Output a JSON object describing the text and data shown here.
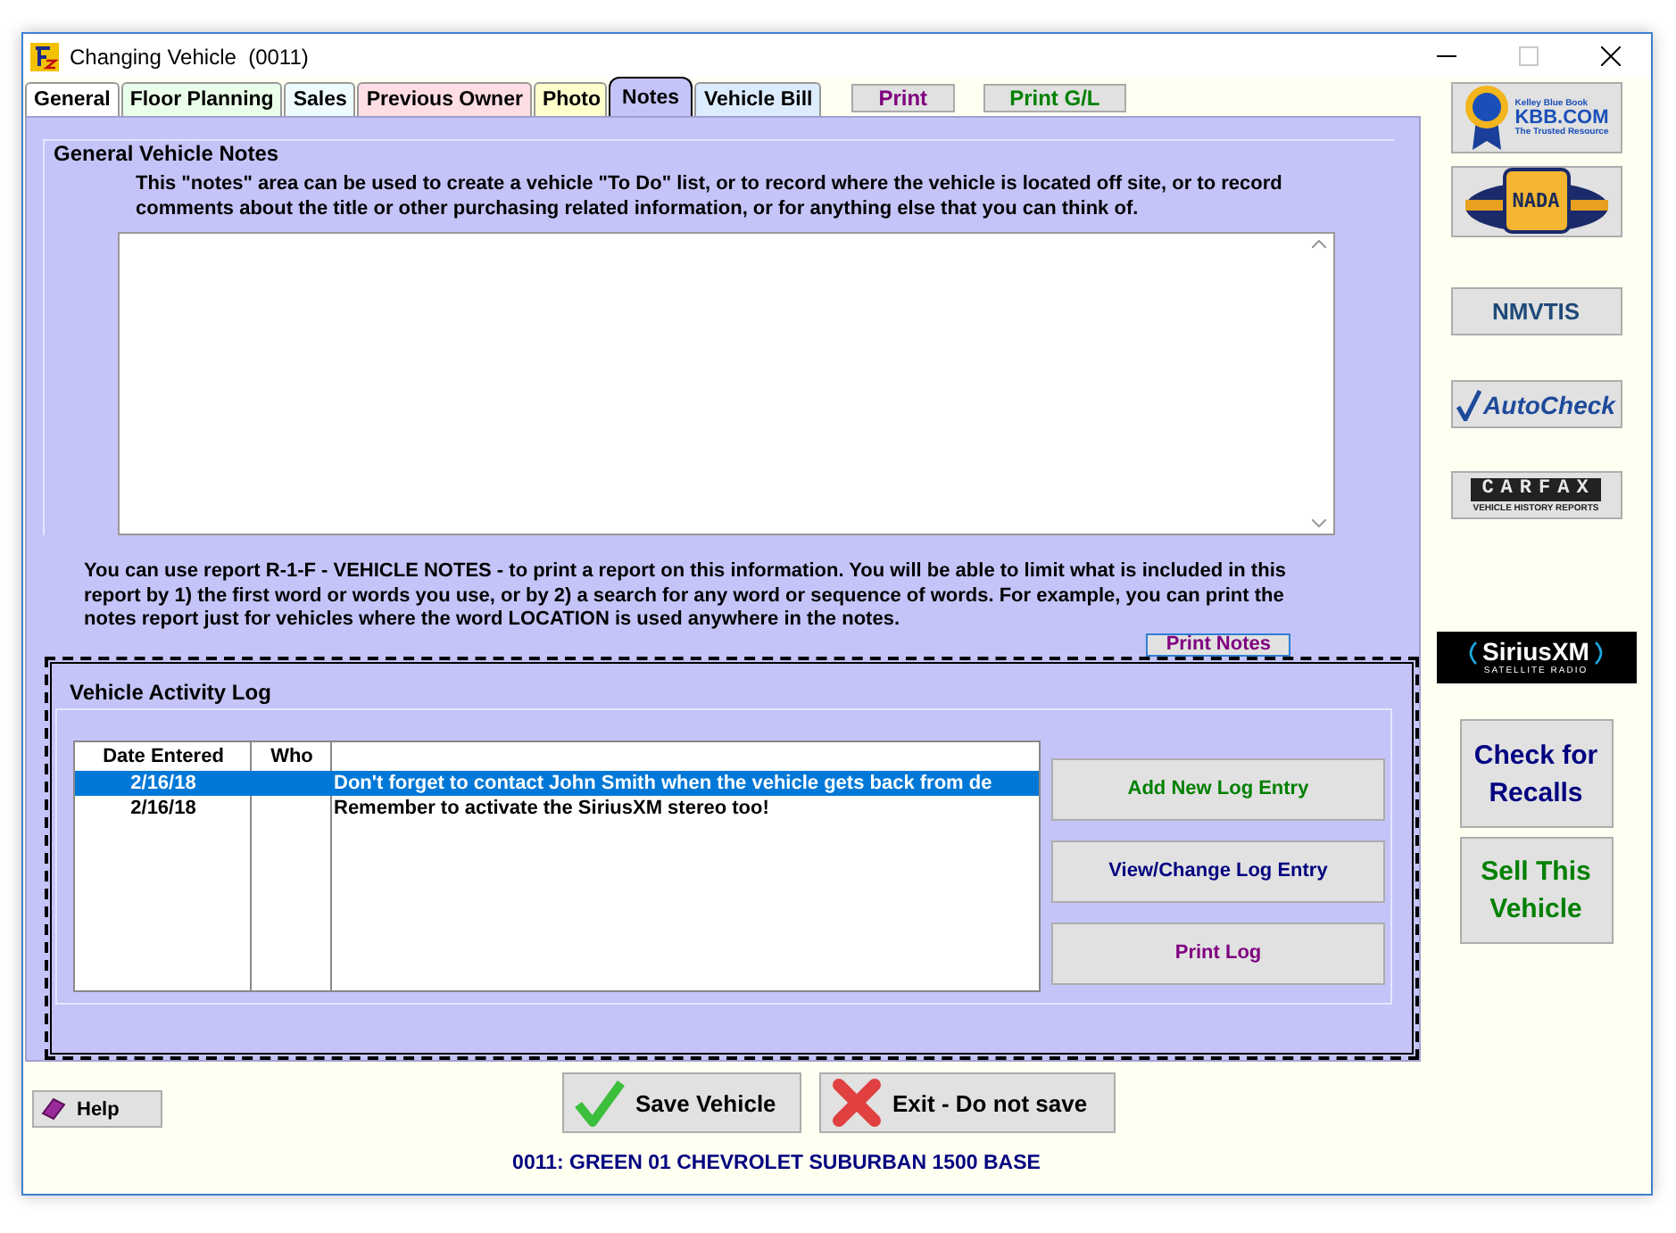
{
  "window": {
    "title": "Changing Vehicle  (0011)",
    "controls": [
      {
        "kind": "minimize",
        "disabled": false
      },
      {
        "kind": "maximize",
        "disabled": true
      },
      {
        "kind": "close",
        "disabled": false
      }
    ]
  },
  "tabs": [
    {
      "label": "General",
      "color": "#ffffff",
      "selected": false
    },
    {
      "label": "Floor Planning",
      "color": "#eaffea",
      "selected": false
    },
    {
      "label": "Sales",
      "color": "#eefcff",
      "selected": false
    },
    {
      "label": "Previous Owner",
      "color": "#ffdde4",
      "selected": false
    },
    {
      "label": "Photo",
      "color": "#ffffcc",
      "selected": false
    },
    {
      "label": "Notes",
      "color": "#c4c4f8",
      "selected": true
    },
    {
      "label": "Vehicle Bill",
      "color": "#dcecff",
      "selected": false
    }
  ],
  "tab_buttons": [
    {
      "label": "Print",
      "color": "#800080"
    },
    {
      "label": "Print G/L",
      "color": "#008000"
    }
  ],
  "general_notes": {
    "title": "General Vehicle Notes",
    "description": "This \"notes\" area can be used to create a vehicle \"To Do\" list, or to record where the vehicle is located off site, or to record comments about the title or other purchasing related information, or for anything else that you can think of."
  },
  "report_info": "You can use report R-1-F - VEHICLE NOTES - to print a report on this information.  You will be able to limit what is included in this report by 1) the first word or words you use, or by 2) a search for any word or sequence of words.  For example, you can print the notes report just for vehicles where the word LOCATION is used anywhere in the notes.",
  "print_notes_button": "Print Notes",
  "activity_log": {
    "title": "Vehicle Activity Log",
    "columns": [
      "Date Entered",
      "Who"
    ],
    "rows": [
      {
        "date": "2/16/18",
        "note": "Don't forget to contact John Smith when the vehicle gets back from de",
        "selected": true
      },
      {
        "date": "2/16/18",
        "note": "Remember to activate the SiriusXM stereo too!",
        "selected": false
      }
    ],
    "buttons": [
      {
        "label": "Add New Log Entry",
        "color": "#008000"
      },
      {
        "label": "View/Change Log Entry",
        "color": "#000080"
      },
      {
        "label": "Print Log",
        "color": "#800080"
      }
    ]
  },
  "side_links": [
    {
      "kind": "kbb",
      "lines": [
        "Kelley Blue Book",
        "KBB.COM",
        "The Trusted Resource"
      ]
    },
    {
      "kind": "nada",
      "lines": [
        "NADA"
      ]
    },
    {
      "kind": "nmvtis",
      "lines": [
        "NMVTIS"
      ]
    },
    {
      "kind": "autocheck",
      "lines": [
        "AutoCheck"
      ]
    },
    {
      "kind": "carfax",
      "lines": [
        "CARFAX",
        "VEHICLE HISTORY REPORTS"
      ]
    },
    {
      "kind": "sirius",
      "lines": [
        "SiriusXM",
        "SATELLITE RADIO"
      ]
    }
  ],
  "side_buttons": [
    {
      "label": "Check for Recalls",
      "color": "#000080"
    },
    {
      "label": "Sell This Vehicle",
      "color": "#008000"
    }
  ],
  "footer": {
    "help": "Help",
    "save": "Save Vehicle",
    "exit": "Exit - Do not save",
    "status": "0011: GREEN 01 CHEVROLET SUBURBAN 1500 BASE"
  }
}
